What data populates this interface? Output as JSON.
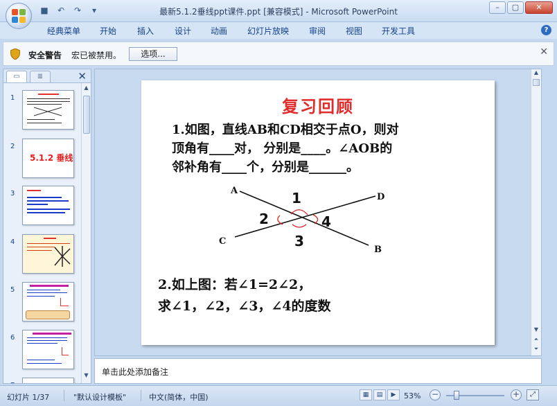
{
  "window": {
    "title": "最新5.1.2垂线ppt课件.ppt [兼容模式] - Microsoft PowerPoint",
    "buttons": [
      "–",
      "▢",
      "✕"
    ]
  },
  "ribbon": {
    "tabs": [
      "经典菜单",
      "开始",
      "插入",
      "设计",
      "动画",
      "幻灯片放映",
      "审阅",
      "视图",
      "开发工具"
    ],
    "help": "?"
  },
  "security_bar": {
    "title": "安全警告",
    "message": "宏已被禁用。",
    "options_button": "选项..."
  },
  "slides_pane": {
    "thumbs": [
      {
        "num": "1",
        "label": ""
      },
      {
        "num": "2",
        "label": "5.1.2 垂线"
      },
      {
        "num": "3",
        "label": ""
      },
      {
        "num": "4",
        "label": ""
      },
      {
        "num": "5",
        "label": ""
      },
      {
        "num": "6",
        "label": ""
      },
      {
        "num": "7",
        "label": ""
      }
    ]
  },
  "slide": {
    "title": "复习回顾",
    "q1_lines": [
      "1.如图，直线AB和CD相交于点O，则对",
      "顶角有____对， 分别是____。∠AOB的",
      "邻补角有____个，分别是______。"
    ],
    "figure": {
      "point_labels": [
        "A",
        "B",
        "C",
        "D"
      ],
      "angle_labels": [
        "1",
        "2",
        "3",
        "4"
      ]
    },
    "q2_lines": [
      "2.如上图：若∠1=2∠2，",
      "求∠1，∠2，∠3，∠4的度数"
    ]
  },
  "notes": {
    "placeholder": "单击此处添加备注"
  },
  "status": {
    "slide_counter": "幻灯片 1/37",
    "template": "\"默认设计模板\"",
    "language": "中文(简体，中国)",
    "zoom": "53%"
  }
}
